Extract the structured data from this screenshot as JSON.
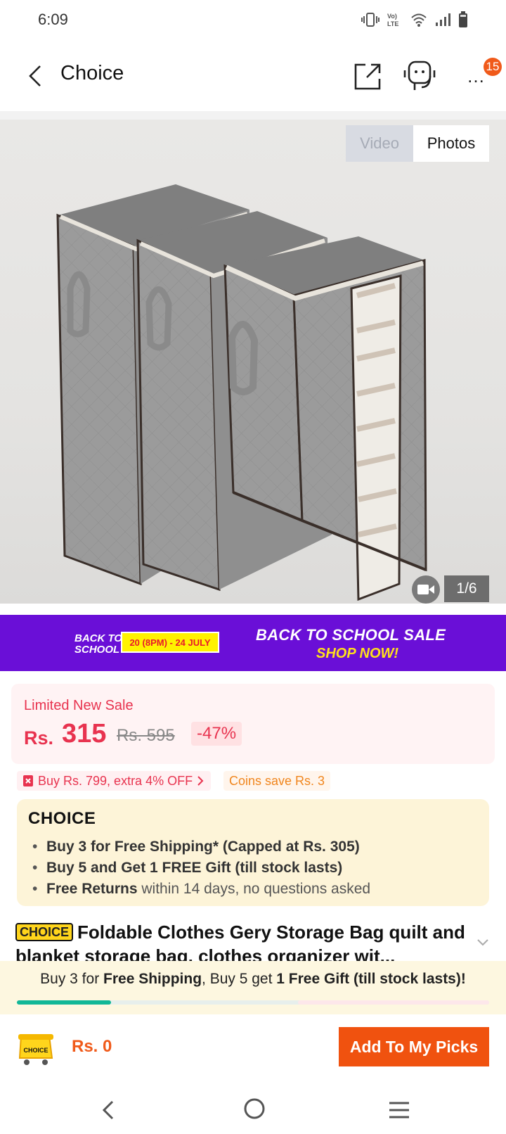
{
  "status_bar": {
    "time": "6:09"
  },
  "header": {
    "title": "Choice",
    "notification_count": "15"
  },
  "gallery": {
    "video_tab": "Video",
    "photos_tab": "Photos",
    "counter": "1/6"
  },
  "promo": {
    "logo_line1": "BACK TO",
    "logo_line2": "SCHOOL",
    "dates": "20 (8PM) - 24 JULY",
    "title": "BACK TO SCHOOL SALE",
    "cta": "SHOP NOW!"
  },
  "price": {
    "label": "Limited New Sale",
    "currency": "Rs.",
    "current": "315",
    "original": "Rs. 595",
    "discount": "-47%"
  },
  "coupons": {
    "extra": "Buy Rs. 799, extra 4% OFF",
    "coins": "Coins save Rs. 3"
  },
  "choice": {
    "logo": "CHOICE",
    "benefit1": "Buy 3 for  Free Shipping* (Capped at Rs. 305)",
    "benefit2": "Buy 5 and Get 1 FREE Gift (till stock lasts)",
    "benefit3_bold": "Free Returns",
    "benefit3_rest": " within 14 days, no questions asked"
  },
  "product": {
    "badge": "CHOICE",
    "title": "Foldable Clothes Gery Storage Bag quilt and blanket storage bag, clothes organizer wit..."
  },
  "shipping_strip": {
    "p1": "Buy 3 for ",
    "p2": "Free Shipping",
    "p3": ", Buy 5 get ",
    "p4": "1 Free Gift (till stock lasts)!",
    "progress": 0.2
  },
  "action_bar": {
    "cart_total": "Rs. 0",
    "cart_label": "CHOICE",
    "add_button": "Add To My Picks"
  },
  "colors": {
    "accent": "#f0520f",
    "sale_red": "#e8334f",
    "promo_purple": "#6a0fd7",
    "choice_yellow": "#ffd51c"
  }
}
